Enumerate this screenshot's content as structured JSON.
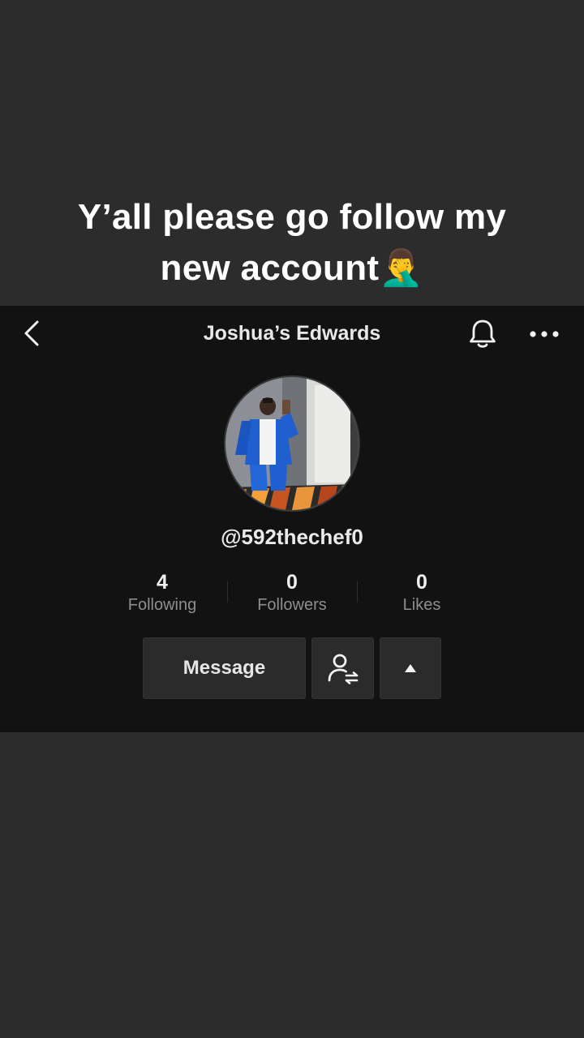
{
  "caption": {
    "line1": "Y’all please go follow my",
    "line2": "new account",
    "emoji": "🤦‍♂️"
  },
  "nav": {
    "title": "Joshua’s Edwards",
    "back_icon": "chevron-left-icon",
    "bell_icon": "bell-icon",
    "more_icon": "ellipsis-icon"
  },
  "profile": {
    "handle": "@592thechef0",
    "avatar": "profile-photo"
  },
  "stats": [
    {
      "count": "4",
      "label": "Following"
    },
    {
      "count": "0",
      "label": "Followers"
    },
    {
      "count": "0",
      "label": "Likes"
    }
  ],
  "actions": {
    "message_label": "Message",
    "friend_icon": "user-swap-icon",
    "toggle_icon": "triangle-up-icon"
  },
  "colors": {
    "page_bg": "#2c2c2c",
    "card_bg": "#121212",
    "button_bg": "#2b2b2b",
    "muted_text": "#8e8e8e"
  }
}
